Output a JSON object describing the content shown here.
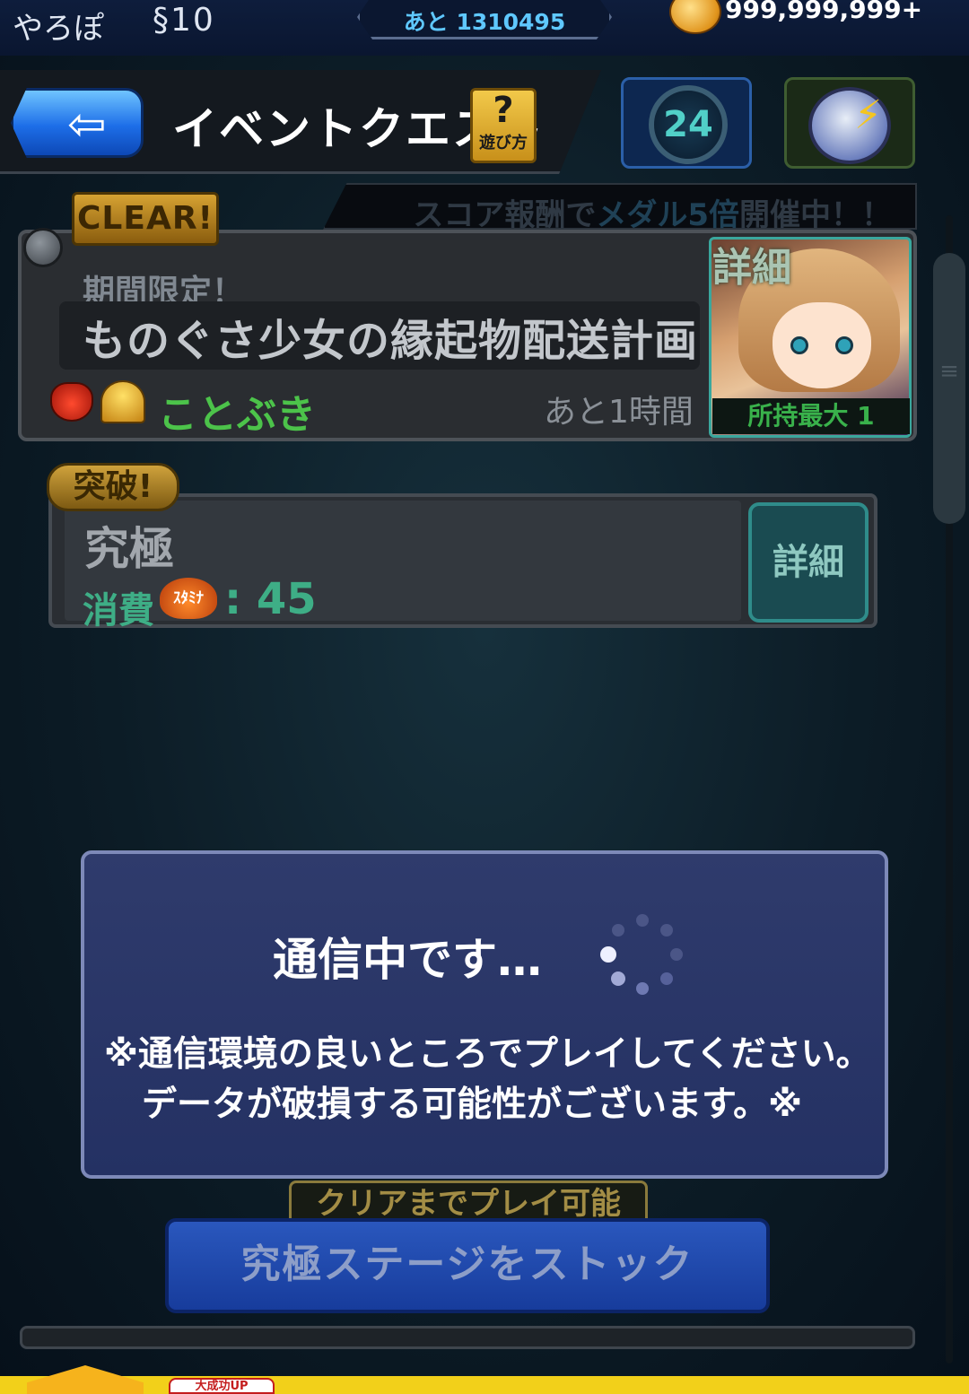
{
  "status": {
    "player_name": "やろぽ",
    "rank": "§10",
    "next_rank": "あと 1310495",
    "coins": "999,999,999+"
  },
  "header": {
    "back_arrow": "⇦",
    "title": "イベントクエスト",
    "howto_symbol": "?",
    "howto_label": "遊び方",
    "stamina_timer": "24",
    "speed_symbol": "⚡"
  },
  "event": {
    "banner_prefix": "スコア報酬で",
    "banner_highlight": "メダル5倍",
    "banner_suffix": "開催中！！",
    "clear_badge": "CLEAR!",
    "period_label": "期間限定！",
    "name": "ものぐさ少女の縁起物配送計画",
    "attribute": "ことぶき",
    "remaining": "あと1時間",
    "detail_label": "詳細",
    "owned_max": "所持最大 1",
    "owned_icon": "♣"
  },
  "stage": {
    "break_badge": "突破!",
    "difficulty": "究極",
    "cost_label": "消費",
    "stamina_badge": "ｽﾀﾐﾅ",
    "cost_value": ": 45",
    "detail_label": "詳細"
  },
  "dialog": {
    "title": "通信中です…",
    "note_line1": "※通信環境の良いところでプレイしてください。",
    "note_line2": "データが破損する可能性がございます。※"
  },
  "actions": {
    "play_until_clear": "クリアまでプレイ可能",
    "stock_button": "究極ステージをストック",
    "footer_badge": "大成功UP"
  },
  "colors": {
    "accent_blue": "#1d6ee8",
    "clear_gold": "#d6a232",
    "attribute_green": "#4cc34a",
    "cost_green": "#3eae86",
    "dialog_bg": "#2f3b6c"
  }
}
